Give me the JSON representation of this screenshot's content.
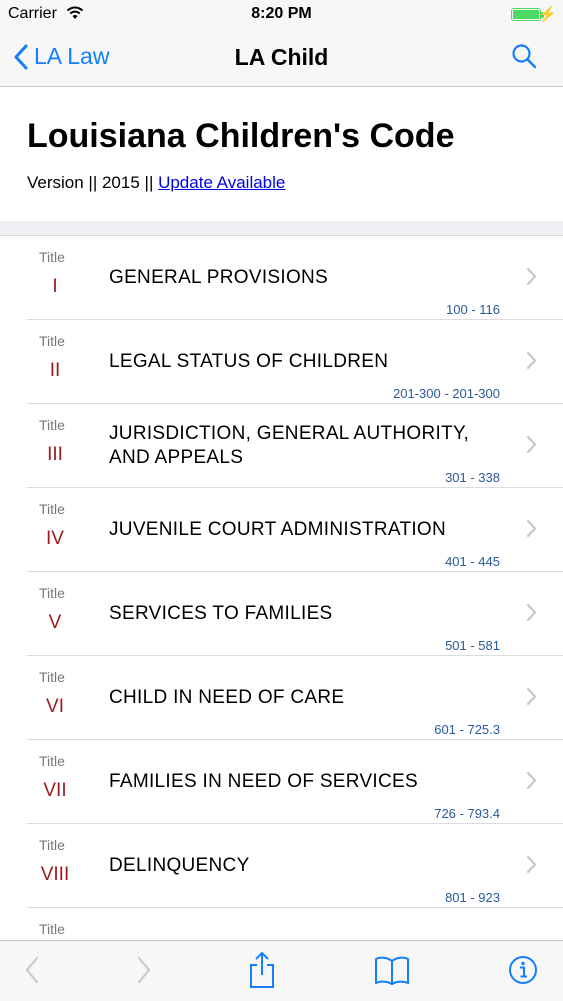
{
  "status_bar": {
    "carrier": "Carrier",
    "time": "8:20 PM"
  },
  "nav": {
    "back_label": "LA Law",
    "title": "LA Child"
  },
  "header": {
    "title": "Louisiana Children's Code",
    "version_text": "Version || 2015 || ",
    "update_link": "Update Available"
  },
  "titles": [
    {
      "word": "Title",
      "numeral": "I",
      "name": "GENERAL PROVISIONS",
      "range": "100 - 116"
    },
    {
      "word": "Title",
      "numeral": "II",
      "name": "LEGAL STATUS OF CHILDREN",
      "range": "201-300 - 201-300"
    },
    {
      "word": "Title",
      "numeral": "III",
      "name": "JURISDICTION, GENERAL AUTHORITY, AND APPEALS",
      "range": "301 - 338"
    },
    {
      "word": "Title",
      "numeral": "IV",
      "name": "JUVENILE COURT ADMINISTRATION",
      "range": "401 - 445"
    },
    {
      "word": "Title",
      "numeral": "V",
      "name": "SERVICES TO FAMILIES",
      "range": "501 - 581"
    },
    {
      "word": "Title",
      "numeral": "VI",
      "name": "CHILD IN NEED OF CARE",
      "range": "601 - 725.3"
    },
    {
      "word": "Title",
      "numeral": "VII",
      "name": "FAMILIES IN NEED OF SERVICES",
      "range": "726 - 793.4"
    },
    {
      "word": "Title",
      "numeral": "VIII",
      "name": "DELINQUENCY",
      "range": "801 - 923"
    },
    {
      "word": "Title",
      "numeral": "",
      "name": "",
      "range": ""
    }
  ],
  "toolbar": {
    "icons": [
      "back-arrow-icon",
      "forward-arrow-icon",
      "share-icon",
      "book-icon",
      "info-icon"
    ]
  },
  "colors": {
    "accent": "#157efb",
    "numeral": "#9b1b1e",
    "range": "#2a5a9a",
    "link": "#0000ee"
  }
}
